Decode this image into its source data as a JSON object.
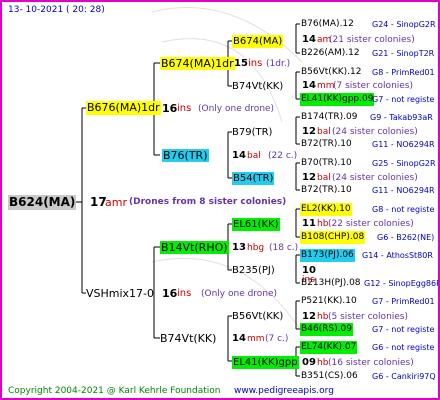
{
  "header": {
    "date": "13- 10-2021 ( 20: 28)"
  },
  "root": {
    "name": "B624(MA)",
    "num": "17",
    "unit": "amr",
    "note": "(Drones from 8 sister colonies)"
  },
  "lvl1": [
    {
      "name": "B676(MA)1dr",
      "num": "16",
      "unit": "ins",
      "note": "(Only one drone)"
    },
    {
      "name": "VSHmix17-0",
      "num": "16",
      "unit": "ins",
      "note": "(Only one drone)"
    }
  ],
  "lvl2": [
    {
      "name": "B674(MA)1dr",
      "num": "15",
      "unit": "ins",
      "note": "(1dr.)"
    },
    {
      "name": "B76(TR)",
      "num": "14",
      "unit": "bal",
      "note": "(22 c.)"
    },
    {
      "name": "B14Vt(RHO)",
      "num": "13",
      "unit": "hbg",
      "note": "(18 c.)"
    },
    {
      "name": "B74Vt(KK)",
      "num": "14",
      "unit": "mm",
      "note": "(7 c.)"
    }
  ],
  "lvl3": [
    {
      "name": "B674(MA)",
      "num": "14",
      "unit": "am",
      "note": "(21 sister colonies)"
    },
    {
      "name": "B74Vt(KK)",
      "num": "14",
      "unit": "mm",
      "note": "(7 sister colonies)"
    },
    {
      "name": "B79(TR)",
      "num": "12",
      "unit": "bal",
      "note": "(24 sister colonies)"
    },
    {
      "name": "B54(TR)",
      "num": "12",
      "unit": "bal",
      "note": "(24 sister colonies)"
    },
    {
      "name": "EL61(KK)",
      "num": "11",
      "unit": "hb",
      "note": "(22 sister colonies)"
    },
    {
      "name": "B235(PJ)",
      "num": "10",
      "unit": "ins",
      "note": ""
    },
    {
      "name": "B56Vt(KK)",
      "num": "12",
      "unit": "hb",
      "note": "(5 sister colonies)"
    },
    {
      "name": "EL41(KK)gpp",
      "num": "09",
      "unit": "hb",
      "note": "(16 sister colonies)"
    }
  ],
  "lvl4": [
    {
      "name": "B76(MA).12",
      "ref": "G24 - SinopG2R"
    },
    {
      "name": "B226(AM).12",
      "ref": "G21 - SinopT2R"
    },
    {
      "name": "B56Vt(KK).12",
      "ref": "G8 - PrimRed01"
    },
    {
      "name": "EL41(KK)gpp.09",
      "ref": "G7 - not registe"
    },
    {
      "name": "B174(TR).09",
      "ref": "G9 - Takab93aR"
    },
    {
      "name": "B72(TR).10",
      "ref": "G11 - NO6294R"
    },
    {
      "name": "B70(TR).10",
      "ref": "G25 - SinopG2R"
    },
    {
      "name": "B72(TR).10",
      "ref": "G11 - NO6294R"
    },
    {
      "name": "EL2(KK).10",
      "ref": "G8 - not registe"
    },
    {
      "name": "B108(CHP).08",
      "ref": "G6 - B262(NE)"
    },
    {
      "name": "B173(PJ).06",
      "ref": "G14 - AthosSt80R"
    },
    {
      "name": "B213H(PJ).08",
      "ref": "G12 - SinopEgg86R"
    },
    {
      "name": "P521(KK).10",
      "ref": "G7 - PrimRed01"
    },
    {
      "name": "B46(RS).09",
      "ref": "G7 - not registe"
    },
    {
      "name": "EL74(KK).07",
      "ref": "G6 - not registe"
    },
    {
      "name": "B351(CS).06",
      "ref": "G6 - Cankiri97Q"
    }
  ],
  "footer": {
    "copyright": "Copyright 2004-2021 @ Karl Kehrle Foundation",
    "url": "www.pedigreeapis.org"
  }
}
